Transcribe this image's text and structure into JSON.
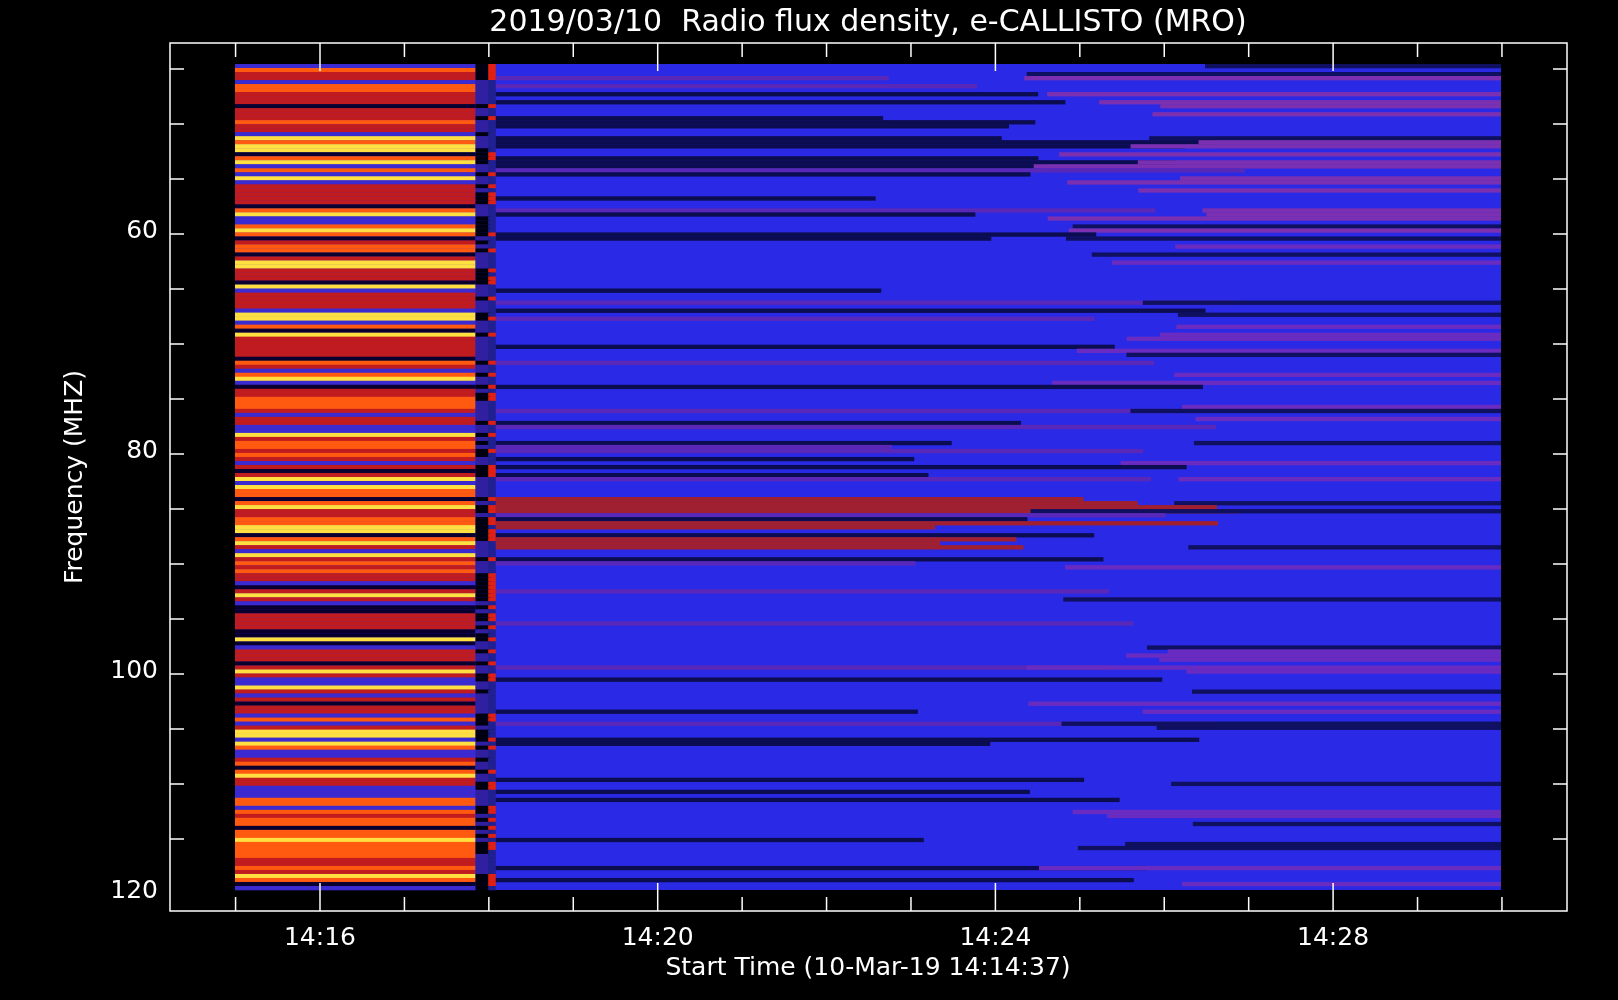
{
  "title": "2019/03/10  Radio flux density, e-CALLISTO (MRO)",
  "y_axis": {
    "label": "Frequency (MHZ)",
    "ticks": [
      "60",
      "80",
      "100",
      "120"
    ]
  },
  "x_axis": {
    "label": "Start Time (10-Mar-19 14:14:37)",
    "ticks": [
      "14:16",
      "14:20",
      "14:24",
      "14:28"
    ]
  }
}
